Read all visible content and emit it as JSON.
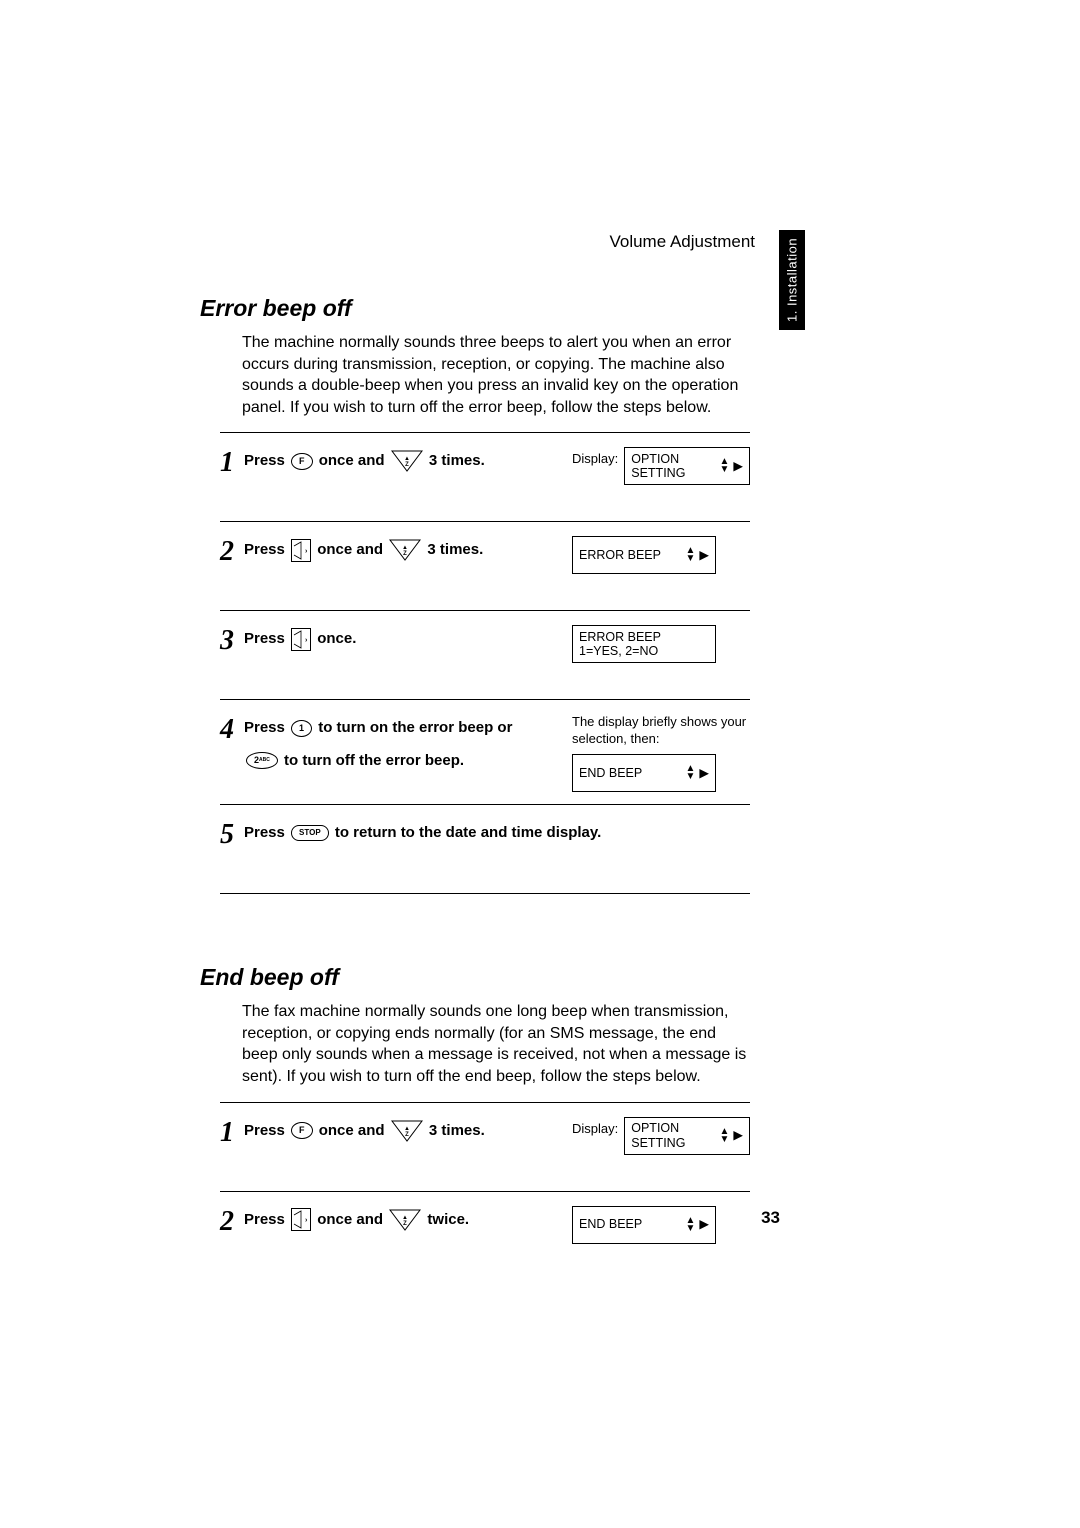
{
  "breadcrumb": "Volume Adjustment",
  "side_tab": "1. Installation",
  "page_number": "33",
  "section1": {
    "title": "Error beep off",
    "intro": "The machine normally sounds three beeps to alert you when an error occurs during transmission, reception, or copying. The machine also sounds a double-beep when you press an invalid key on the operation panel. If you wish to turn off the error beep, follow the steps below.",
    "steps": [
      {
        "num": "1",
        "press": "Press",
        "key1": "F",
        "mid1": "once and",
        "tail": "3 times.",
        "display_label": "Display:",
        "screen": {
          "line1": "OPTION SETTING",
          "arrows": true
        }
      },
      {
        "num": "2",
        "press": "Press",
        "mid1": "once and",
        "tail": "3 times.",
        "screen": {
          "line1": "ERROR BEEP",
          "arrows": true
        }
      },
      {
        "num": "3",
        "press": "Press",
        "tail": "once.",
        "screen": {
          "line1": "ERROR BEEP",
          "line2": "1=YES, 2=NO"
        }
      },
      {
        "num": "4",
        "press": "Press",
        "key1": "1",
        "mid1": "to turn on the error beep or",
        "key2": "2",
        "key2sub": "ABC",
        "mid2": "to turn off the error beep.",
        "note": "The display briefly shows your selection, then:",
        "screen": {
          "line1": "END BEEP",
          "arrows": true
        }
      },
      {
        "num": "5",
        "press": "Press",
        "key1": "STOP",
        "tail": "to return to the date and time display."
      }
    ]
  },
  "section2": {
    "title": "End beep off",
    "intro": "The fax machine normally sounds one long beep when transmission, reception, or copying ends normally (for an SMS message, the end beep only sounds when a message is received, not when a message is sent). If you wish to turn off the end beep, follow the steps below.",
    "steps": [
      {
        "num": "1",
        "press": "Press",
        "key1": "F",
        "mid1": "once and",
        "tail": "3 times.",
        "display_label": "Display:",
        "screen": {
          "line1": "OPTION SETTING",
          "arrows": true
        }
      },
      {
        "num": "2",
        "press": "Press",
        "mid1": "once and",
        "tail": "twice.",
        "screen": {
          "line1": "END BEEP",
          "arrows": true
        }
      }
    ]
  }
}
